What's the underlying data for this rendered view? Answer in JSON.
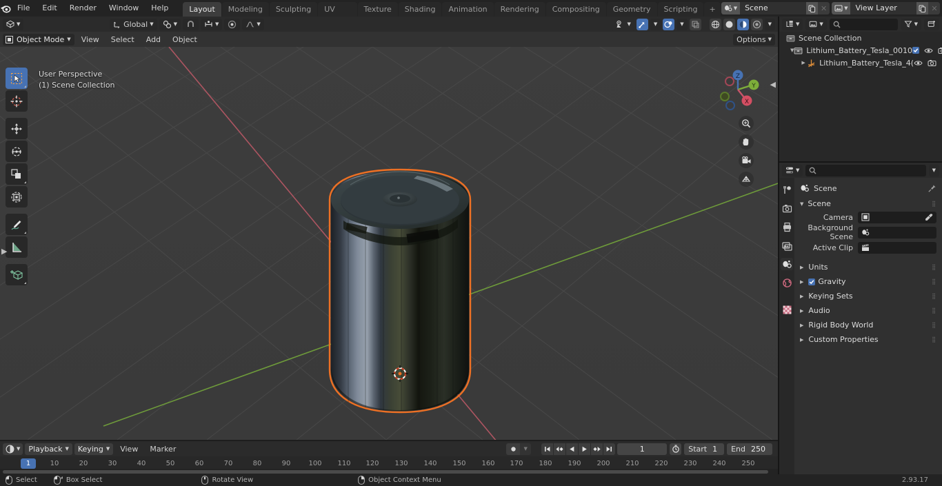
{
  "app": {
    "name": "Blender",
    "version": "2.93.17"
  },
  "topbar": {
    "logo_icon": "blender-logo-icon",
    "menus": [
      "File",
      "Edit",
      "Render",
      "Window",
      "Help"
    ],
    "workspaces": [
      {
        "label": "Layout",
        "active": true
      },
      {
        "label": "Modeling",
        "active": false
      },
      {
        "label": "Sculpting",
        "active": false
      },
      {
        "label": "UV Editing",
        "active": false
      },
      {
        "label": "Texture Paint",
        "active": false
      },
      {
        "label": "Shading",
        "active": false
      },
      {
        "label": "Animation",
        "active": false
      },
      {
        "label": "Rendering",
        "active": false
      },
      {
        "label": "Compositing",
        "active": false
      },
      {
        "label": "Geometry Nodes",
        "active": false
      },
      {
        "label": "Scripting",
        "active": false
      }
    ],
    "add_workspace_label": "+",
    "scene": {
      "icon": "scene-icon",
      "name": "Scene",
      "new_label": "new-scene-icon",
      "unlink_label": "×"
    },
    "view_layer": {
      "icon": "view-layer-icon",
      "name": "View Layer",
      "new_label": "new-layer-icon",
      "unlink_label": "×"
    }
  },
  "viewport": {
    "header": {
      "editor_type_icon": "editor-type-3dview-icon",
      "transform_orientation": "Global",
      "snap_icon": "magnet-icon",
      "proportional_icon": "proportional-edit-icon",
      "options_label": "Options",
      "shading_modes": [
        "wireframe",
        "solid",
        "material-preview",
        "rendered"
      ],
      "active_shading_index": 2
    },
    "subheader": {
      "mode": "Object Mode",
      "menus": [
        "View",
        "Select",
        "Add",
        "Object"
      ]
    },
    "overlay": {
      "line1": "User Perspective",
      "line2": "(1) Scene Collection"
    },
    "tools": [
      {
        "name": "tweak-tool",
        "active": true
      },
      {
        "name": "cursor-tool",
        "active": false
      },
      {
        "name": "move-tool",
        "active": false
      },
      {
        "name": "rotate-tool",
        "active": false
      },
      {
        "name": "scale-tool",
        "active": false
      },
      {
        "name": "transform-tool",
        "active": false
      },
      {
        "name": "annotate-tool",
        "active": false
      },
      {
        "name": "measure-tool",
        "active": false
      },
      {
        "name": "add-cube-tool",
        "active": false
      }
    ],
    "gizmo_axes": [
      "X",
      "Y",
      "Z"
    ],
    "nav_buttons": [
      "zoom-icon",
      "pan-hand-icon",
      "camera-icon",
      "orthographic-grid-icon"
    ],
    "object_name": "Lithium_Battery_Tesla",
    "colors": {
      "background": "#3b3b3b",
      "grid": "#4a4a4a",
      "axis_x": "#c9546a",
      "axis_y": "#7dad3a",
      "selection_outline": "#ed7024"
    }
  },
  "outliner": {
    "display_mode_icon": "outliner-display-mode-icon",
    "filter_id_icon": "id-type-icon",
    "search_placeholder": "",
    "filter_icon": "filter-funnel-icon",
    "new_collection_icon": "new-collection-icon",
    "rows": [
      {
        "label": "Scene Collection",
        "icon": "collection-icon",
        "depth": 0,
        "expanded": null,
        "selected": false,
        "checkbox": false,
        "eye": false,
        "camera": false
      },
      {
        "label": "Lithium_Battery_Tesla_0010",
        "icon": "collection-icon",
        "depth": 1,
        "expanded": true,
        "selected": false,
        "checkbox": true,
        "eye": true,
        "camera": true
      },
      {
        "label": "Lithium_Battery_Tesla_4(",
        "icon": "empty-axis-icon",
        "depth": 2,
        "expanded": false,
        "selected": false,
        "checkbox": false,
        "eye": true,
        "camera": true
      }
    ]
  },
  "properties": {
    "editor_icon": "properties-editor-icon",
    "search_placeholder": "",
    "tabs": [
      {
        "name": "tool-tab",
        "active": false
      },
      {
        "name": "render-tab",
        "active": false
      },
      {
        "name": "output-tab",
        "active": false
      },
      {
        "name": "view-layer-tab",
        "active": false
      },
      {
        "name": "scene-tab",
        "active": true
      },
      {
        "name": "world-tab",
        "active": false
      },
      {
        "name": "texture-tab",
        "active": false
      }
    ],
    "breadcrumb": "Scene",
    "pin_icon": "pin-icon",
    "panel_title": "Scene",
    "fields": [
      {
        "label": "Camera",
        "value": "",
        "icon": "camera-data-icon",
        "eyedropper": true
      },
      {
        "label": "Background Scene",
        "value": "",
        "icon": "scene-icon",
        "eyedropper": false
      },
      {
        "label": "Active Clip",
        "value": "",
        "icon": "movie-clip-icon",
        "eyedropper": false
      }
    ],
    "sections": [
      {
        "label": "Units",
        "checkbox": null
      },
      {
        "label": "Gravity",
        "checkbox": true
      },
      {
        "label": "Keying Sets",
        "checkbox": null
      },
      {
        "label": "Audio",
        "checkbox": null
      },
      {
        "label": "Rigid Body World",
        "checkbox": null
      },
      {
        "label": "Custom Properties",
        "checkbox": null
      }
    ]
  },
  "timeline": {
    "editor_icon": "timeline-editor-icon",
    "menus": [
      "Playback",
      "Keying"
    ],
    "plain_menus": [
      "View",
      "Marker"
    ],
    "auto_key_icon": "record-dot-icon",
    "transport": [
      "jump-to-start-icon",
      "jump-to-prev-keyframe-icon",
      "play-reverse-icon",
      "play-icon",
      "jump-to-next-keyframe-icon",
      "jump-to-end-icon"
    ],
    "current_frame": "1",
    "timer_icon": "use-preview-range-icon",
    "start_label": "Start",
    "start_value": "1",
    "end_label": "End",
    "end_value": "250",
    "ruler_ticks": [
      "10",
      "20",
      "30",
      "40",
      "50",
      "60",
      "70",
      "80",
      "90",
      "100",
      "110",
      "120",
      "130",
      "140",
      "150",
      "160",
      "170",
      "180",
      "190",
      "200",
      "210",
      "220",
      "230",
      "240",
      "250"
    ],
    "playhead_frame": "1"
  },
  "statusbar": {
    "items": [
      {
        "icon": "mouse-left-icon",
        "label": "Select"
      },
      {
        "icon": "mouse-left-drag-icon",
        "label": "Box Select"
      },
      {
        "icon": "mouse-middle-icon",
        "label": "Rotate View"
      },
      {
        "icon": "mouse-right-icon",
        "label": "Object Context Menu"
      }
    ],
    "version": "2.93.17"
  }
}
